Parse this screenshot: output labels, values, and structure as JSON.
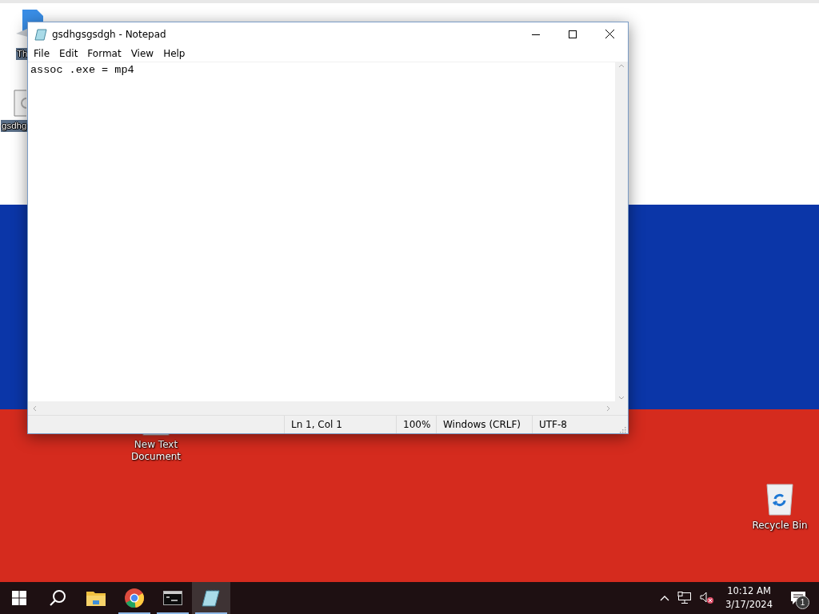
{
  "desktop_icons": [
    {
      "kind": "folder",
      "label": "Th"
    },
    {
      "kind": "file",
      "label": "gsdhg"
    },
    {
      "kind": "text",
      "label": "New Text Document"
    },
    {
      "kind": "bin",
      "label": "Recycle Bin"
    }
  ],
  "window": {
    "title": "gsdhgsgsdgh - Notepad",
    "menu": [
      "File",
      "Edit",
      "Format",
      "View",
      "Help"
    ],
    "content": "assoc .exe = mp4",
    "status_bar": [
      "Ln 1, Col 1",
      "100%",
      "Windows (CRLF)",
      "UTF-8"
    ]
  },
  "taskbar": {
    "apps": [
      {
        "kind": "explorer",
        "running": false,
        "selected": false
      },
      {
        "kind": "chrome",
        "running": true,
        "selected": false
      },
      {
        "kind": "terminal",
        "running": true,
        "selected": false
      },
      {
        "kind": "notepad",
        "running": true,
        "selected": true
      }
    ],
    "time": "10:12 AM",
    "date": "3/17/2024",
    "notifications": "1"
  }
}
